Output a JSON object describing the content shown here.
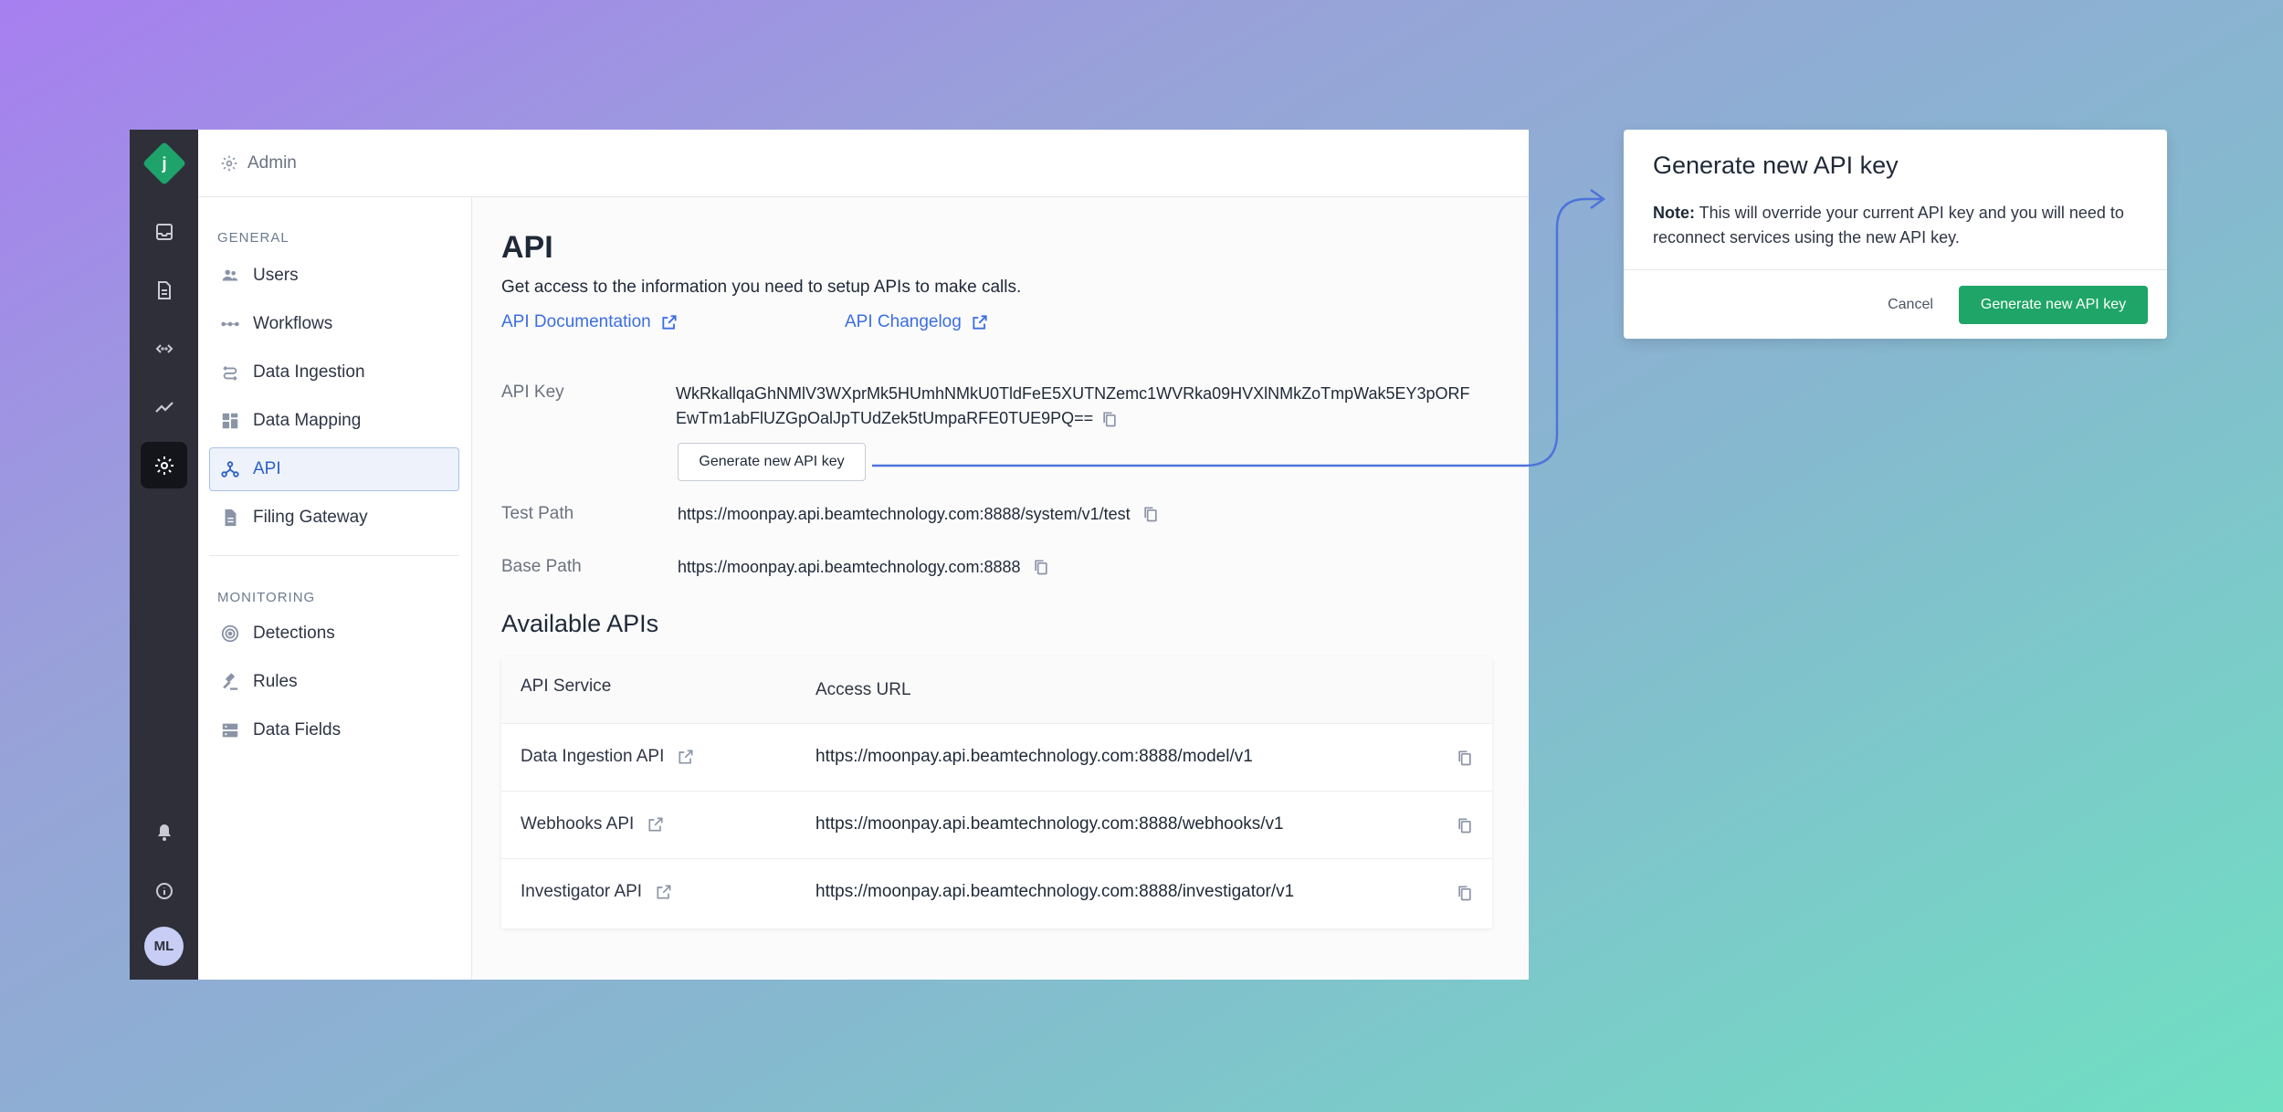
{
  "app": {
    "logo_letter": "j",
    "breadcrumb": "Admin",
    "avatar_initials": "ML",
    "accent_color": "#3b6ee0",
    "primary_button_color": "#1fa567"
  },
  "rail": {
    "icons": [
      "inbox-icon",
      "document-icon",
      "code-icon",
      "trend-icon",
      "gear-icon",
      "bell-icon",
      "info-icon"
    ]
  },
  "sidebar": {
    "general_label": "GENERAL",
    "monitoring_label": "MONITORING",
    "general_items": [
      {
        "label": "Users",
        "icon": "users-icon"
      },
      {
        "label": "Workflows",
        "icon": "workflow-icon"
      },
      {
        "label": "Data Ingestion",
        "icon": "ingestion-icon"
      },
      {
        "label": "Data Mapping",
        "icon": "grid-icon"
      },
      {
        "label": "API",
        "icon": "api-icon",
        "active": true
      },
      {
        "label": "Filing Gateway",
        "icon": "file-icon"
      }
    ],
    "monitoring_items": [
      {
        "label": "Detections",
        "icon": "radar-icon"
      },
      {
        "label": "Rules",
        "icon": "gavel-icon"
      },
      {
        "label": "Data Fields",
        "icon": "storage-icon"
      }
    ]
  },
  "main": {
    "title": "API",
    "subtitle": "Get access to the information you need to setup APIs to make calls.",
    "doc_link": "API Documentation",
    "changelog_link": "API Changelog",
    "api_key_label": "API Key",
    "api_key_value": "WkRkallqaGhNMlV3WXprMk5HUmhNMkU0TldFeE5XUTNZemc1WVRka09HVXlNMkZoTmpWak5EY3pORFEwTm1abFlUZGpOalJpTUdZek5tUmpaRFE0TUE9PQ==",
    "generate_button": "Generate new API key",
    "test_path_label": "Test Path",
    "test_path_value": "https://moonpay.api.beamtechnology.com:8888/system/v1/test",
    "base_path_label": "Base Path",
    "base_path_value": "https://moonpay.api.beamtechnology.com:8888",
    "available_title": "Available APIs",
    "table_headers": [
      "API Service",
      "Access URL"
    ],
    "table_rows": [
      {
        "service": "Data Ingestion API",
        "url": "https://moonpay.api.beamtechnology.com:8888/model/v1"
      },
      {
        "service": "Webhooks API",
        "url": "https://moonpay.api.beamtechnology.com:8888/webhooks/v1"
      },
      {
        "service": "Investigator API",
        "url": "https://moonpay.api.beamtechnology.com:8888/investigator/v1"
      }
    ]
  },
  "modal": {
    "title": "Generate new API key",
    "note_label": "Note:",
    "note_text": " This will override your current API key and you will need to reconnect services using the new API key.",
    "cancel_label": "Cancel",
    "confirm_label": "Generate new API key"
  }
}
